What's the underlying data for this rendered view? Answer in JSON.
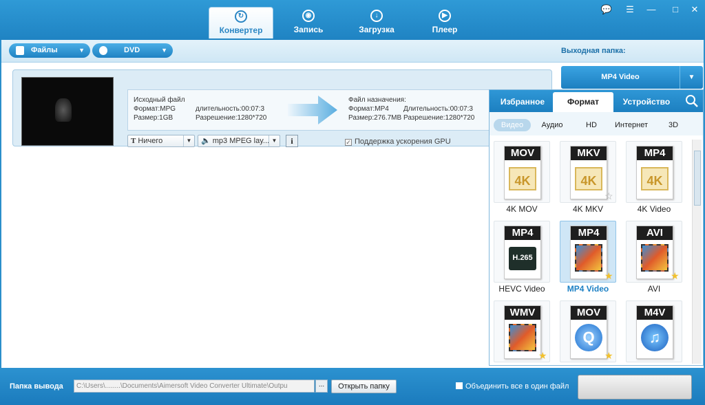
{
  "window": {
    "controls": [
      "💬",
      "☰",
      "—",
      "□",
      "✕"
    ]
  },
  "tabs": [
    {
      "label": "Конвертер",
      "icon": "↻",
      "active": true
    },
    {
      "label": "Запись",
      "icon": "◉"
    },
    {
      "label": "Загрузка",
      "icon": "↓"
    },
    {
      "label": "Плеер",
      "icon": "▶"
    }
  ],
  "toolbar": {
    "files_label": "Файлы",
    "dvd_label": "DVD",
    "output_folder_label": "Выходная папка:"
  },
  "file": {
    "source_title": "Исходный файл",
    "source_format": "Формат:MPG",
    "source_duration": "длительность:00:07:3",
    "source_size": "Размер:1GB",
    "source_resolution": "Разрешение:1280*720",
    "dest_title": "Файл назначения:",
    "dest_format": "Формат:MP4",
    "dest_duration": "Длительность:00:07:3",
    "dest_size": "Размер:276.7MB",
    "dest_resolution": "Разрешение:1280*720",
    "subtitle_value": "Ничего",
    "audio_value": "mp3 MPEG lay...",
    "info_label": "i",
    "gpu_label": "Поддержка ускорения GPU"
  },
  "output_format": {
    "name": "MP4 Video"
  },
  "format_panel": {
    "tabs": [
      "Избранное",
      "Формат",
      "Устройство"
    ],
    "active_tab": 1,
    "subtabs": [
      "Видео",
      "Аудио",
      "HD",
      "Интернет",
      "3D"
    ],
    "active_subtab": 0,
    "items": [
      {
        "band": "MOV",
        "art": "4K",
        "name": "4K MOV",
        "star": ""
      },
      {
        "band": "MKV",
        "art": "4K",
        "name": "4K MKV",
        "star": "☆"
      },
      {
        "band": "MP4",
        "art": "4K",
        "name": "4K Video",
        "star": ""
      },
      {
        "band": "MP4",
        "art": "H.265",
        "name": "HEVC Video",
        "star": ""
      },
      {
        "band": "MP4",
        "art": "",
        "name": "MP4 Video",
        "star": "★",
        "selected": true
      },
      {
        "band": "AVI",
        "art": "",
        "name": "AVI",
        "star": "★"
      },
      {
        "band": "WMV",
        "art": "",
        "name": "",
        "star": "★"
      },
      {
        "band": "MOV",
        "art": "Q",
        "name": "",
        "star": "★"
      },
      {
        "band": "M4V",
        "art": "♫",
        "name": "",
        "star": ""
      }
    ]
  },
  "bottom": {
    "output_folder_label": "Папка вывода",
    "output_path": "C:\\Users\\........\\Documents\\Aimersoft Video Converter Ultimate\\Outpu",
    "browse_label": "...",
    "open_folder_label": "Открыть папку",
    "merge_label": "Объединить все в один файл"
  },
  "colors": {
    "accent": "#2b8fcb",
    "dark_accent": "#1c7fc0",
    "selected_text": "#1a7fc4"
  }
}
